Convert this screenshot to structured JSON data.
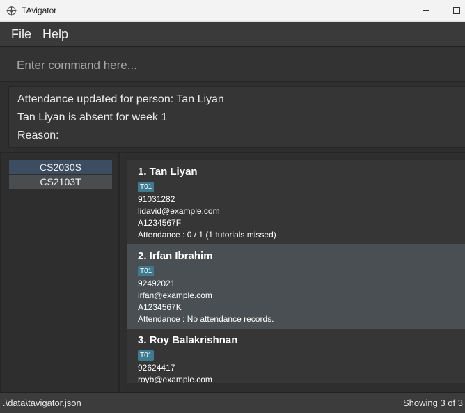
{
  "window": {
    "title": "TAvigator",
    "app_icon": "crosshair-icon"
  },
  "menu": {
    "items": [
      {
        "label": "File"
      },
      {
        "label": "Help"
      }
    ]
  },
  "command": {
    "placeholder": "Enter command here...",
    "value": ""
  },
  "result": {
    "lines": [
      "Attendance updated for person: Tan Liyan",
      "Tan Liyan is absent for week 1",
      "Reason:"
    ]
  },
  "courses": [
    {
      "label": "CS2030S",
      "selected": true
    },
    {
      "label": "CS2103T",
      "selected": false
    }
  ],
  "persons": [
    {
      "name": "1.  Tan Liyan",
      "tag": "T01",
      "phone": "91031282",
      "email": "lidavid@example.com",
      "student_id": "A1234567F",
      "attendance": "Attendance : 0 / 1 (1 tutorials missed)"
    },
    {
      "name": "2.  Irfan Ibrahim",
      "tag": "T01",
      "phone": "92492021",
      "email": "irfan@example.com",
      "student_id": "A1234567K",
      "attendance": "Attendance : No attendance records."
    },
    {
      "name": "3.  Roy Balakrishnan",
      "tag": "T01",
      "phone": "92624417",
      "email": "royb@example.com",
      "student_id": "",
      "attendance": ""
    }
  ],
  "status": {
    "path": ".\\data\\tavigator.json",
    "count": "Showing 3 of 3"
  }
}
